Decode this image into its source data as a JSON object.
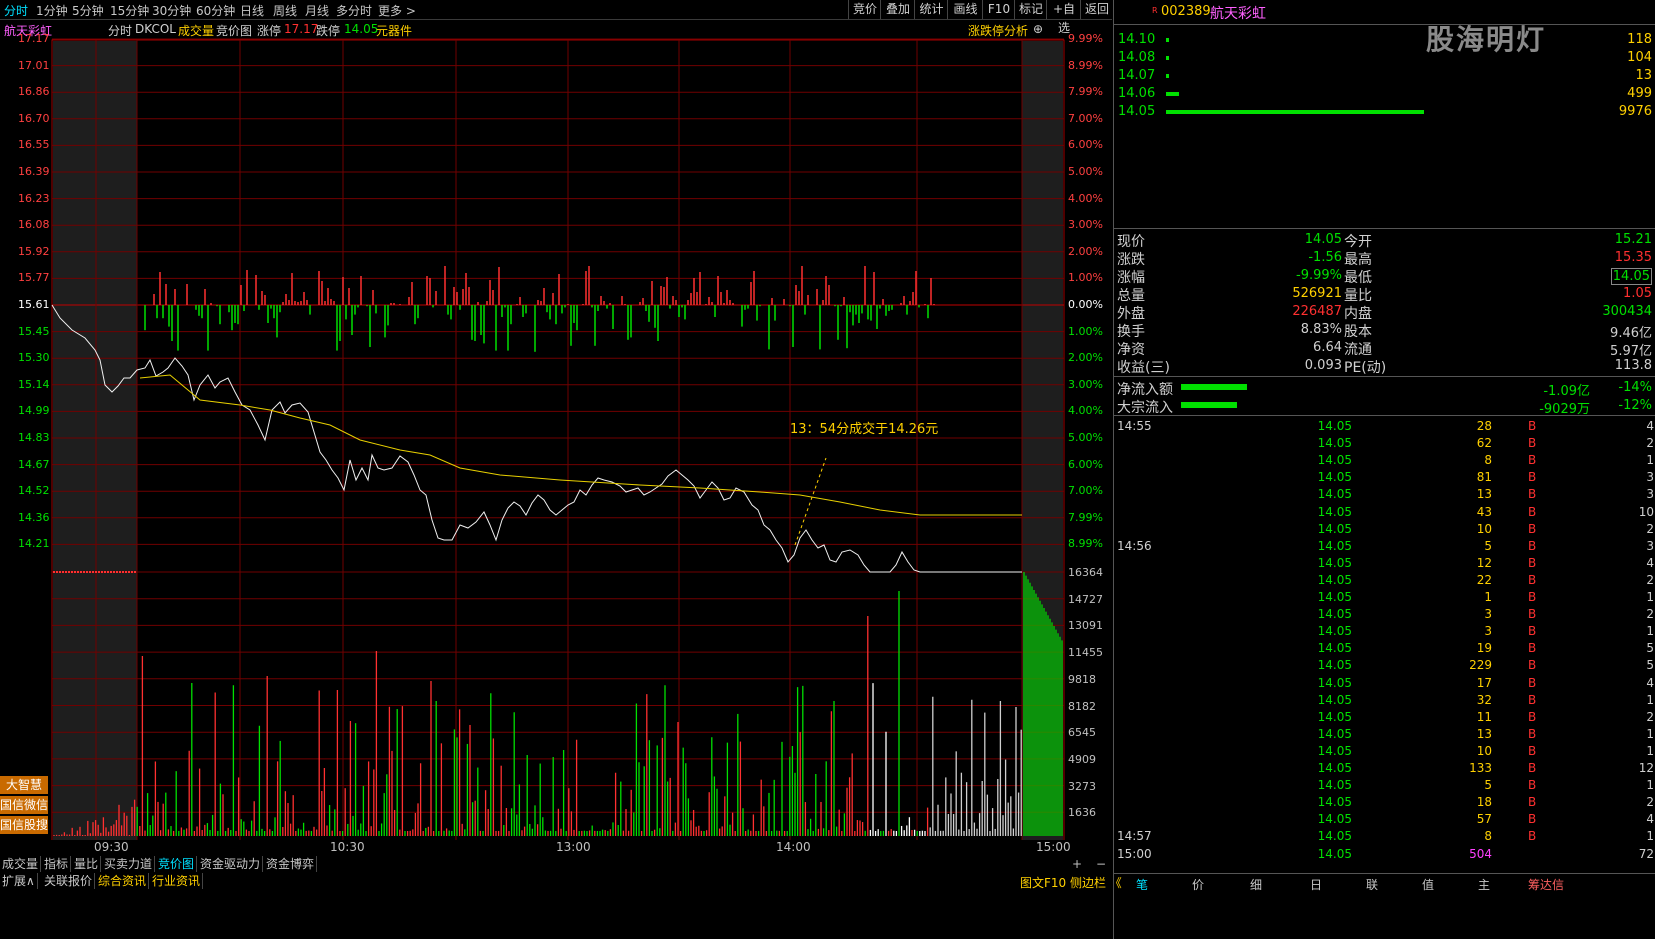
{
  "top_tabs": [
    "分时",
    "1分钟",
    "5分钟",
    "15分钟",
    "30分钟",
    "60分钟",
    "日线",
    "周线",
    "月线",
    "多分时",
    "更多"
  ],
  "top_buttons": [
    "竞价",
    "叠加",
    "统计",
    "画线",
    "F10",
    "标记",
    "+自选",
    "返回"
  ],
  "info": {
    "name": "航天彩虹",
    "mode": "分时",
    "indicator": "DKCOL",
    "vol_label": "成交量",
    "auction_label": "竞价图",
    "up_label": "涨停",
    "up_value": "17.17",
    "down_label": "跌停",
    "down_value": "14.05",
    "sector": "元器件",
    "analysis": "涨跌停分析"
  },
  "price_labels": [
    "17.17",
    "17.01",
    "16.86",
    "16.70",
    "16.55",
    "16.39",
    "16.23",
    "16.08",
    "15.92",
    "15.77",
    "15.61",
    "15.45",
    "15.30",
    "15.14",
    "14.99",
    "14.83",
    "14.67",
    "14.52",
    "14.36",
    "14.21"
  ],
  "pct_labels": [
    "9.99%",
    "8.99%",
    "7.99%",
    "7.00%",
    "6.00%",
    "5.00%",
    "4.00%",
    "3.00%",
    "2.00%",
    "1.00%",
    "0.00%",
    "1.00%",
    "2.00%",
    "3.00%",
    "4.00%",
    "5.00%",
    "6.00%",
    "7.00%",
    "7.99%",
    "8.99%"
  ],
  "vol_labels": [
    "16364",
    "14727",
    "13091",
    "11455",
    "9818",
    "8182",
    "6545",
    "4909",
    "3273",
    "1636"
  ],
  "time_labels": [
    "09:30",
    "10:30",
    "13:00",
    "14:00",
    "15:00"
  ],
  "annotation": "13：54分成交于14.26元",
  "side_buttons": [
    "大智慧",
    "国信微信",
    "国信股搜"
  ],
  "bottom_tabs": [
    "成交量",
    "指标",
    "量比",
    "买卖力道",
    "竞价图",
    "资金驱动力",
    "资金博弈"
  ],
  "bottom_tabs2": [
    "扩展∧",
    "关联报价",
    "综合资讯",
    "行业资讯"
  ],
  "bottom_right": "图文F10 侧边栏 《",
  "right": {
    "code": "002389",
    "name": "航天彩虹",
    "flag": "R",
    "watermark": "股海明灯",
    "orderbook": [
      {
        "price": "14.10",
        "vol": "118",
        "frac": 0.012
      },
      {
        "price": "14.08",
        "vol": "104",
        "frac": 0.01
      },
      {
        "price": "14.07",
        "vol": "13",
        "frac": 0.002
      },
      {
        "price": "14.06",
        "vol": "499",
        "frac": 0.05
      },
      {
        "price": "14.05",
        "vol": "9976",
        "frac": 1.0
      }
    ],
    "quote": [
      [
        "现价",
        "14.05",
        "今开",
        "15.21"
      ],
      [
        "涨跌",
        "-1.56",
        "最高",
        "15.35"
      ],
      [
        "涨幅",
        "-9.99%",
        "最低",
        "14.05"
      ],
      [
        "总量",
        "526921",
        "量比",
        "1.05"
      ],
      [
        "外盘",
        "226487",
        "内盘",
        "300434"
      ],
      [
        "换手",
        "8.83%",
        "股本",
        "9.46亿"
      ],
      [
        "净资",
        "6.64",
        "流通",
        "5.97亿"
      ],
      [
        "收益(三)",
        "0.093",
        "PE(动)",
        "113.8"
      ]
    ],
    "flows": [
      {
        "label": "净流入额",
        "value": "-1.09亿",
        "pct": "-14%",
        "frac": 0.14
      },
      {
        "label": "大宗流入",
        "value": "-9029万",
        "pct": "-12%",
        "frac": 0.12
      }
    ],
    "trades": [
      {
        "t": "14:55",
        "p": "14.05",
        "v": "28",
        "s": "B",
        "n": "4"
      },
      {
        "t": "",
        "p": "14.05",
        "v": "62",
        "s": "B",
        "n": "2"
      },
      {
        "t": "",
        "p": "14.05",
        "v": "8",
        "s": "B",
        "n": "1"
      },
      {
        "t": "",
        "p": "14.05",
        "v": "81",
        "s": "B",
        "n": "3"
      },
      {
        "t": "",
        "p": "14.05",
        "v": "13",
        "s": "B",
        "n": "3"
      },
      {
        "t": "",
        "p": "14.05",
        "v": "43",
        "s": "B",
        "n": "10"
      },
      {
        "t": "",
        "p": "14.05",
        "v": "10",
        "s": "B",
        "n": "2"
      },
      {
        "t": "14:56",
        "p": "14.05",
        "v": "5",
        "s": "B",
        "n": "3"
      },
      {
        "t": "",
        "p": "14.05",
        "v": "12",
        "s": "B",
        "n": "4"
      },
      {
        "t": "",
        "p": "14.05",
        "v": "22",
        "s": "B",
        "n": "2"
      },
      {
        "t": "",
        "p": "14.05",
        "v": "1",
        "s": "B",
        "n": "1"
      },
      {
        "t": "",
        "p": "14.05",
        "v": "3",
        "s": "B",
        "n": "2"
      },
      {
        "t": "",
        "p": "14.05",
        "v": "3",
        "s": "B",
        "n": "1"
      },
      {
        "t": "",
        "p": "14.05",
        "v": "19",
        "s": "B",
        "n": "5"
      },
      {
        "t": "",
        "p": "14.05",
        "v": "229",
        "s": "B",
        "n": "5"
      },
      {
        "t": "",
        "p": "14.05",
        "v": "17",
        "s": "B",
        "n": "4"
      },
      {
        "t": "",
        "p": "14.05",
        "v": "32",
        "s": "B",
        "n": "1"
      },
      {
        "t": "",
        "p": "14.05",
        "v": "11",
        "s": "B",
        "n": "2"
      },
      {
        "t": "",
        "p": "14.05",
        "v": "13",
        "s": "B",
        "n": "1"
      },
      {
        "t": "",
        "p": "14.05",
        "v": "10",
        "s": "B",
        "n": "1"
      },
      {
        "t": "",
        "p": "14.05",
        "v": "133",
        "s": "B",
        "n": "12"
      },
      {
        "t": "",
        "p": "14.05",
        "v": "5",
        "s": "B",
        "n": "1"
      },
      {
        "t": "",
        "p": "14.05",
        "v": "18",
        "s": "B",
        "n": "2"
      },
      {
        "t": "",
        "p": "14.05",
        "v": "57",
        "s": "B",
        "n": "4"
      },
      {
        "t": "14:57",
        "p": "14.05",
        "v": "8",
        "s": "B",
        "n": "1"
      },
      {
        "t": "15:00",
        "p": "14.05",
        "v": "504",
        "s": "",
        "n": "72"
      }
    ],
    "bottom_tabs": [
      "笔",
      "价",
      "细",
      "日",
      "联",
      "值",
      "主",
      "筹达信"
    ]
  },
  "colors": {
    "up": "#ff3030",
    "down": "#00e000",
    "grid": "#a00000",
    "text": "#c0c0c0",
    "accent": "#ffd000"
  }
}
